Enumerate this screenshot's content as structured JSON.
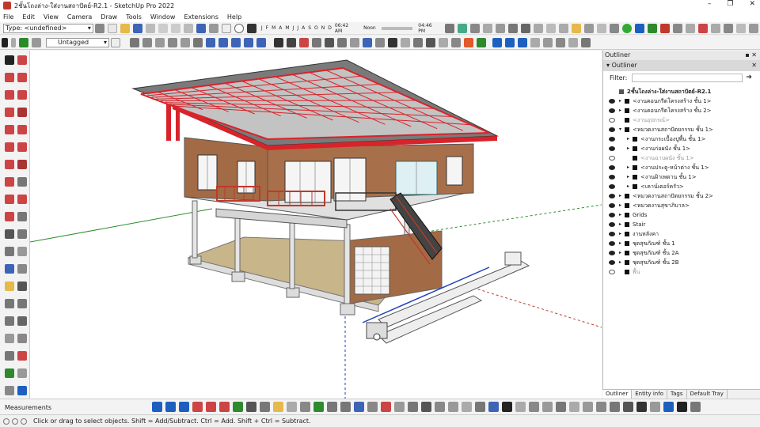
{
  "window": {
    "title": "2ชั้นโถงล่าง-ใส่งานสถาปัตย์-R2.1 - SketchUp Pro 2022",
    "controls": [
      "–",
      "❐",
      "✕"
    ]
  },
  "menu": [
    "File",
    "Edit",
    "View",
    "Camera",
    "Draw",
    "Tools",
    "Window",
    "Extensions",
    "Help"
  ],
  "toolbar": {
    "type_value": "Type: <undefined>",
    "tag_value": "Untagged",
    "months": [
      "J",
      "F",
      "M",
      "A",
      "M",
      "J",
      "J",
      "A",
      "S",
      "O",
      "N",
      "D"
    ],
    "time_start": "06:42 AM",
    "time_noon": "Noon",
    "time_end": "04:46 PM"
  },
  "outliner": {
    "window_title": "Outliner",
    "panel_title": "Outliner",
    "filter_label": "Filter:",
    "model_name": "2ชั้นโถงล่าง-ใส่งานสถาปัตย์-R2.1",
    "rows": [
      {
        "label": "<งานคอนกรีตโครงสร้าง ชั้น 1>",
        "visible": true,
        "depth": 1,
        "expand": "▸"
      },
      {
        "label": "<งานคอนกรีตโครงสร้าง ชั้น 2>",
        "visible": true,
        "depth": 1,
        "expand": "▸"
      },
      {
        "label": "<งานอุปกรณ์>",
        "visible": false,
        "depth": 1,
        "expand": ""
      },
      {
        "label": "<หมวดงานสถาปัตยกรรม ชั้น 1>",
        "visible": true,
        "depth": 1,
        "expand": "▾"
      },
      {
        "label": "<งานกระเบื้องปูพื้น ชั้น 1>",
        "visible": true,
        "depth": 2,
        "expand": "▸"
      },
      {
        "label": "<งานก่อผนัง ชั้น 1>",
        "visible": true,
        "depth": 2,
        "expand": "▸"
      },
      {
        "label": "<งานฉาบผนัง ชั้น 1>",
        "visible": false,
        "depth": 2,
        "expand": ""
      },
      {
        "label": "<งานประตู-หน้าต่าง ชั้น 1>",
        "visible": true,
        "depth": 2,
        "expand": "▸"
      },
      {
        "label": "<งานฝ้าเพดาน ชั้น 1>",
        "visible": true,
        "depth": 2,
        "expand": "▸"
      },
      {
        "label": "<เคาน์เตอร์ครัว>",
        "visible": true,
        "depth": 2,
        "expand": "▸"
      },
      {
        "label": "<หมวดงานสถาปัตยกรรม ชั้น 2>",
        "visible": true,
        "depth": 1,
        "expand": "▸"
      },
      {
        "label": "<หมวดงานสุขาภิบาล>",
        "visible": true,
        "depth": 1,
        "expand": "▸"
      },
      {
        "label": "Grids",
        "visible": true,
        "depth": 1,
        "expand": "▸"
      },
      {
        "label": "Stair",
        "visible": true,
        "depth": 1,
        "expand": "▸"
      },
      {
        "label": "งานหลังคา",
        "visible": true,
        "depth": 1,
        "expand": "▸"
      },
      {
        "label": "ชุดสุขภัณฑ์ ชั้น 1",
        "visible": true,
        "depth": 1,
        "expand": "▸"
      },
      {
        "label": "ชุดสุขภัณฑ์ ชั้น 2A",
        "visible": true,
        "depth": 1,
        "expand": "▸"
      },
      {
        "label": "ชุดสุขภัณฑ์ ชั้น 2B",
        "visible": true,
        "depth": 1,
        "expand": "▸"
      },
      {
        "label": "พื้น",
        "visible": false,
        "depth": 1,
        "expand": ""
      }
    ],
    "tabs": [
      "Outliner",
      "Entity info",
      "Tags",
      "Default Tray"
    ]
  },
  "measurements_label": "Measurements",
  "status_text": "Click or drag to select objects. Shift = Add/Subtract. Ctrl = Add. Shift + Ctrl = Subtract.",
  "colors": {
    "roof_frame": "#d9232a",
    "roof_sheet": "#7a7a7a",
    "brick": "#a26a45",
    "concrete": "#cfcfcf",
    "axis_green": "#2e8b2e",
    "axis_blue": "#1f3fbf"
  }
}
